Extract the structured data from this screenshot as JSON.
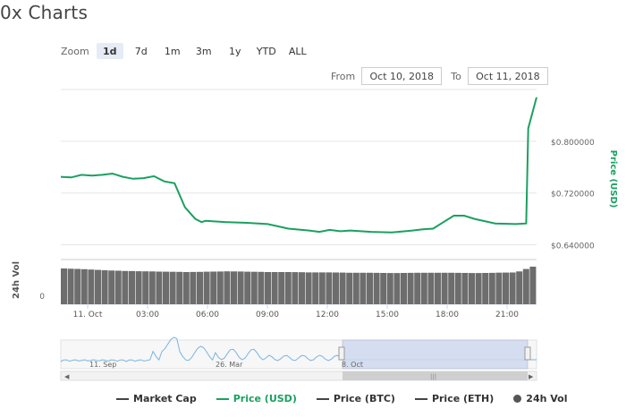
{
  "page": {
    "title": "0x Charts"
  },
  "zoom": {
    "label": "Zoom",
    "buttons": [
      "1d",
      "7d",
      "1m",
      "3m",
      "1y",
      "YTD",
      "ALL"
    ],
    "active": "1d"
  },
  "range": {
    "from_label": "From",
    "from_value": "Oct 10, 2018",
    "to_label": "To",
    "to_value": "Oct 11, 2018"
  },
  "legend": {
    "items": [
      {
        "label": "Market Cap",
        "color": "#434348",
        "shape": "line"
      },
      {
        "label": "Price (USD)",
        "color": "#1aa060",
        "shape": "line"
      },
      {
        "label": "Price (BTC)",
        "color": "#434348",
        "shape": "line"
      },
      {
        "label": "Price (ETH)",
        "color": "#434348",
        "shape": "line"
      },
      {
        "label": "24h Vol",
        "color": "#555555",
        "shape": "dot"
      }
    ]
  },
  "navigator": {
    "labels": [
      "11. Sep",
      "26. Mar",
      "8. Oct"
    ],
    "selection": "1d"
  },
  "colors": {
    "price_line": "#1aa060",
    "volume_bar": "#6d6d6d",
    "navigator_fill": "#cfd8ef",
    "navigator_line": "#7ab4e0"
  },
  "chart_data": {
    "type": "line",
    "x_ticks": [
      "11. Oct",
      "03:00",
      "06:00",
      "09:00",
      "12:00",
      "15:00",
      "18:00",
      "21:00"
    ],
    "price_axis": {
      "label": "Price (USD)",
      "ticks": [
        "$0.800000",
        "$0.720000",
        "$0.640000"
      ],
      "range": [
        0.62,
        0.88
      ]
    },
    "volume_axis": {
      "label": "24h Vol",
      "ticks": [
        "0"
      ]
    },
    "series": [
      {
        "name": "Price (USD)",
        "time_hours": [
          0,
          0.5,
          1,
          1.5,
          2,
          2.5,
          3,
          3.5,
          4,
          4.5,
          5,
          5.5,
          6,
          6.5,
          6.8,
          7,
          7.5,
          8,
          9,
          10,
          11,
          12,
          12.5,
          13,
          13.5,
          14,
          15,
          16,
          17,
          17.5,
          18,
          18.5,
          19,
          19.5,
          20,
          21,
          22,
          22.5,
          22.6,
          23
        ],
        "values": [
          0.745,
          0.744,
          0.748,
          0.747,
          0.748,
          0.75,
          0.745,
          0.742,
          0.743,
          0.746,
          0.738,
          0.735,
          0.698,
          0.68,
          0.675,
          0.677,
          0.676,
          0.675,
          0.674,
          0.672,
          0.665,
          0.662,
          0.66,
          0.663,
          0.661,
          0.662,
          0.66,
          0.659,
          0.662,
          0.664,
          0.665,
          0.675,
          0.685,
          0.685,
          0.68,
          0.673,
          0.672,
          0.673,
          0.82,
          0.868
        ]
      },
      {
        "name": "24h Vol",
        "time_hours": [
          0,
          1,
          2,
          3,
          4,
          5,
          6,
          7,
          8,
          9,
          10,
          11,
          12,
          13,
          14,
          15,
          16,
          17,
          18,
          19,
          20,
          21,
          22,
          22.8
        ],
        "values": [
          1.0,
          0.98,
          0.95,
          0.93,
          0.92,
          0.91,
          0.9,
          0.91,
          0.92,
          0.91,
          0.9,
          0.9,
          0.89,
          0.89,
          0.88,
          0.88,
          0.87,
          0.88,
          0.88,
          0.88,
          0.87,
          0.88,
          0.89,
          1.05
        ]
      }
    ]
  }
}
